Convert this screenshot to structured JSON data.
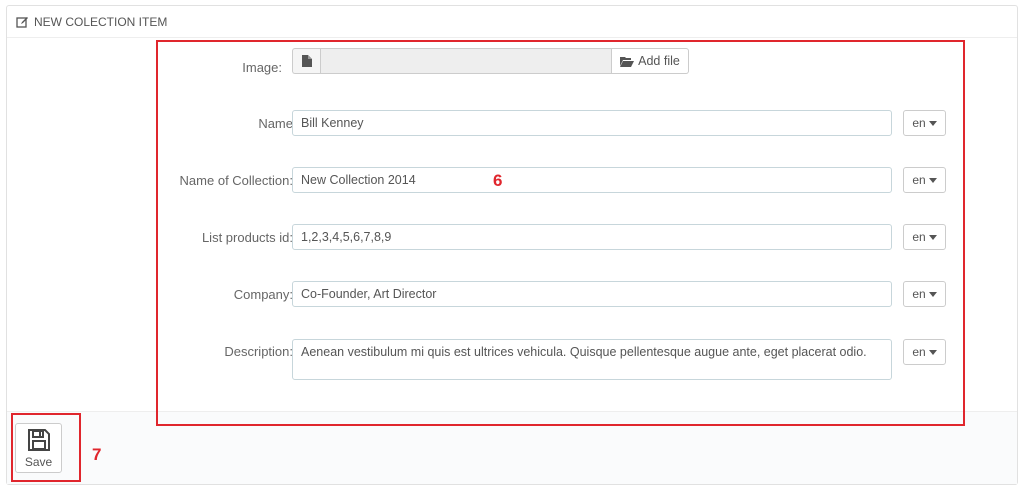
{
  "panel": {
    "title": "NEW COLECTION ITEM"
  },
  "form": {
    "image": {
      "label": "Image:",
      "add_file_label": "Add file"
    },
    "name": {
      "label": "Name",
      "value": "Bill Kenney",
      "lang": "en"
    },
    "collection": {
      "label": "Name of Collection:",
      "value": "New Collection 2014",
      "lang": "en"
    },
    "products": {
      "label": "List products id:",
      "value": "1,2,3,4,5,6,7,8,9",
      "lang": "en"
    },
    "company": {
      "label": "Company:",
      "value": "Co-Founder, Art Director",
      "lang": "en"
    },
    "description": {
      "label": "Description:",
      "value": "Aenean vestibulum mi quis est ultrices vehicula. Quisque pellentesque augue ante, eget placerat odio.",
      "lang": "en"
    }
  },
  "footer": {
    "save_label": "Save"
  },
  "annotations": {
    "form_marker": "6",
    "save_marker": "7"
  },
  "colors": {
    "annotation_red": "#e0262d"
  },
  "icons": {
    "heading": "edit-icon",
    "file": "file-icon",
    "folder": "folder-open-icon",
    "save": "floppy-disk-icon",
    "dropdown": "caret-down-icon"
  }
}
